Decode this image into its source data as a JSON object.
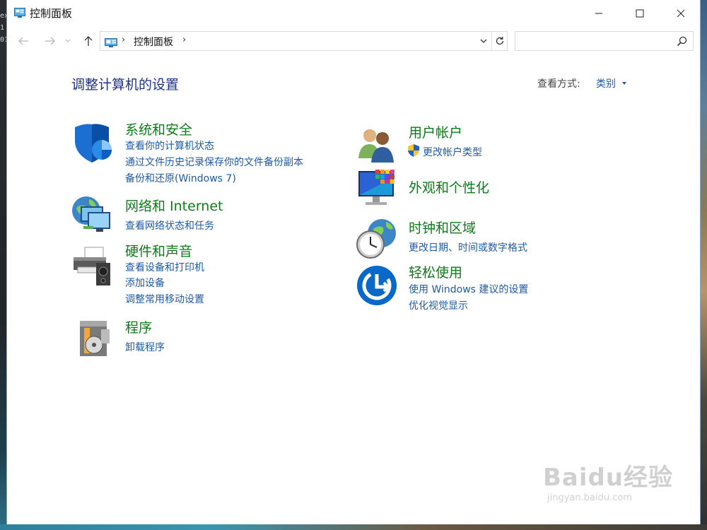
{
  "window": {
    "title": "控制面板",
    "controls": {
      "minimize": "minimize",
      "maximize": "maximize",
      "close": "close"
    }
  },
  "address_bar": {
    "breadcrumb": [
      "控制面板"
    ],
    "search_placeholder": ""
  },
  "header": {
    "title": "调整计算机的设置",
    "view_by_label": "查看方式:",
    "view_by_value": "类别"
  },
  "categories": [
    {
      "title": "系统和安全",
      "icon": "shield-icon",
      "links": [
        "查看你的计算机状态",
        "通过文件历史记录保存你的文件备份副本",
        "备份和还原(Windows 7)"
      ]
    },
    {
      "title": "网络和 Internet",
      "icon": "network-globe-icon",
      "links": [
        "查看网络状态和任务"
      ]
    },
    {
      "title": "硬件和声音",
      "icon": "printer-speaker-icon",
      "links": [
        "查看设备和打印机",
        "添加设备",
        "调整常用移动设置"
      ]
    },
    {
      "title": "程序",
      "icon": "programs-disc-icon",
      "links": [
        "卸载程序"
      ]
    },
    {
      "title": "用户帐户",
      "icon": "users-icon",
      "links": [
        "更改帐户类型"
      ]
    },
    {
      "title": "外观和个性化",
      "icon": "monitor-palette-icon",
      "links": []
    },
    {
      "title": "时钟和区域",
      "icon": "clock-globe-icon",
      "links": [
        "更改日期、时间或数字格式"
      ]
    },
    {
      "title": "轻松使用",
      "icon": "ease-of-access-icon",
      "links": [
        "使用 Windows 建议的设置",
        "优化视觉显示"
      ]
    }
  ],
  "background_terminal_text": [
    "ex",
    "1",
    "01"
  ],
  "watermark": {
    "line1": "Baidu经验",
    "line2": "jingyan.baidu.com"
  },
  "colors": {
    "category_title": "#0e7a1a",
    "link": "#1e5aa6",
    "page_title": "#1e3287"
  }
}
